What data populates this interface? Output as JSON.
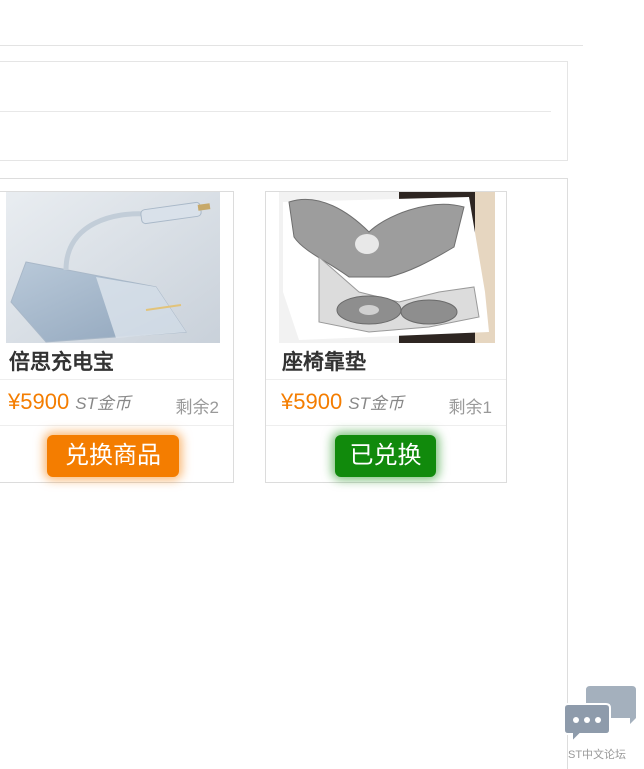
{
  "products": [
    {
      "name": "倍思充电宝",
      "price": "¥5900",
      "currency": "ST金币",
      "stock": "剩余2",
      "button_label": "兑换商品",
      "button_state": "available",
      "image_icon": "power-bank"
    },
    {
      "name": "座椅靠垫",
      "price": "¥5900",
      "currency": "ST金币",
      "stock": "剩余1",
      "button_label": "已兑换",
      "button_state": "redeemed",
      "image_icon": "seat-cushion"
    }
  ],
  "forum_badge": {
    "label": "ST中文论坛",
    "icon": "chat-bubbles-icon"
  },
  "colors": {
    "accent_orange": "#f47d00",
    "success_green": "#118a0c",
    "badge_gray": "#9aa7b6"
  }
}
